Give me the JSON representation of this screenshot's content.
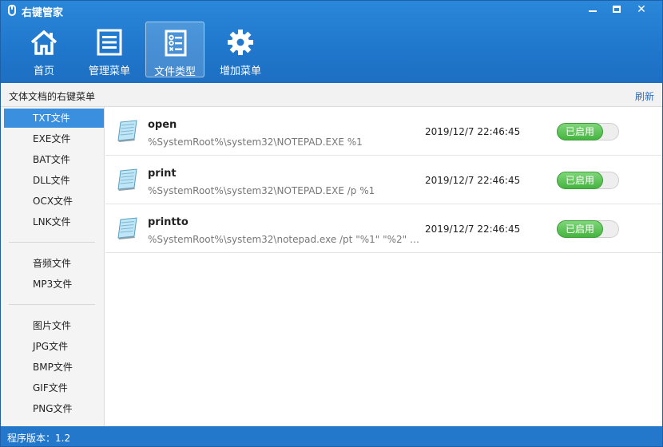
{
  "window": {
    "title": "右键管家",
    "colors": {
      "header": "#2077cc",
      "accent": "#3a8fde",
      "toggle_on": "#45b43f",
      "statusbar": "#2478cc"
    }
  },
  "nav": [
    {
      "label": "首页",
      "icon": "home-icon"
    },
    {
      "label": "管理菜单",
      "icon": "list-icon"
    },
    {
      "label": "文件类型",
      "icon": "checklist-icon",
      "active": true
    },
    {
      "label": "增加菜单",
      "icon": "gear-icon"
    }
  ],
  "toolbar": {
    "title": "文体文档的右键菜单",
    "refresh_label": "刷新"
  },
  "sidebar": {
    "groups": [
      [
        "TXT文件",
        "EXE文件",
        "BAT文件",
        "DLL文件",
        "OCX文件",
        "LNK文件"
      ],
      [
        "音频文件",
        "MP3文件"
      ],
      [
        "图片文件",
        "JPG文件",
        "BMP文件",
        "GIF文件",
        "PNG文件"
      ]
    ],
    "selected": "TXT文件"
  },
  "items": [
    {
      "name": "open",
      "command": "%SystemRoot%\\system32\\NOTEPAD.EXE %1",
      "time": "2019/12/7 22:46:45",
      "status": "已启用"
    },
    {
      "name": "print",
      "command": "%SystemRoot%\\system32\\NOTEPAD.EXE /p %1",
      "time": "2019/12/7 22:46:45",
      "status": "已启用"
    },
    {
      "name": "printto",
      "command": "%SystemRoot%\\system32\\notepad.exe /pt \"%1\" \"%2\" \"%...",
      "time": "2019/12/7 22:46:45",
      "status": "已启用"
    }
  ],
  "status": {
    "version_text": "程序版本：1.2"
  }
}
